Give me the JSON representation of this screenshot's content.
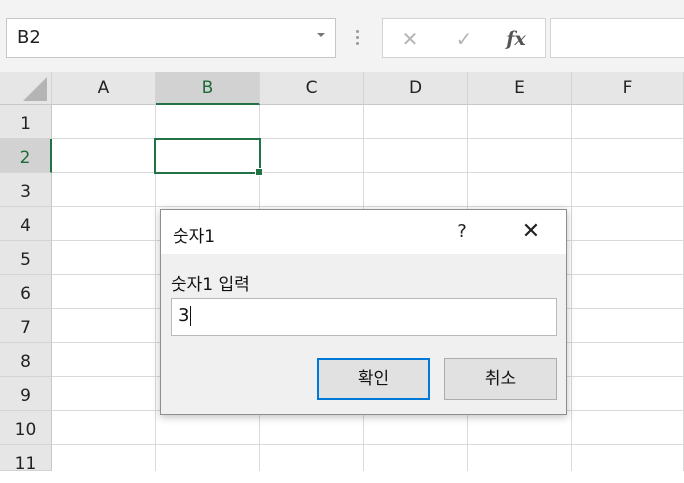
{
  "formula_bar": {
    "name_box": "B2",
    "formula_value": ""
  },
  "sheet": {
    "columns": [
      "A",
      "B",
      "C",
      "D",
      "E",
      "F"
    ],
    "rows": [
      "1",
      "2",
      "3",
      "4",
      "5",
      "6",
      "7",
      "8",
      "9",
      "10",
      "11"
    ],
    "selected_column": "B",
    "selected_row": "2",
    "accent_color": "#217346"
  },
  "dialog": {
    "title": "숫자1",
    "help": "?",
    "close": "✕",
    "prompt": "숫자1 입력",
    "input_value": "3",
    "ok_label": "확인",
    "cancel_label": "취소",
    "focus_color": "#0078d7"
  },
  "icons": {
    "cancel": "✕",
    "enter": "✓",
    "function": "fx"
  }
}
